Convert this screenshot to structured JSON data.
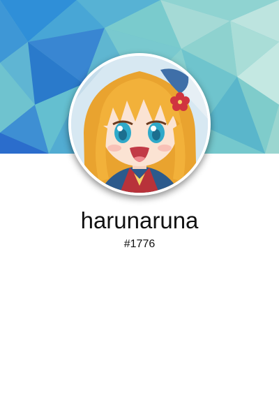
{
  "profile": {
    "username": "harunaruna",
    "discriminator": "#1776"
  },
  "banner": {
    "pattern": "low-poly-triangles",
    "colors": [
      "#2e8fd6",
      "#4aa3d8",
      "#62bcd0",
      "#7ccdcb",
      "#9ad8d2",
      "#b9e3de",
      "#3b7fd1"
    ]
  },
  "avatar": {
    "subject": "anime girl with blonde hair, red flower hair ornament, smiling",
    "colors": {
      "hair": "#f2b13a",
      "skin": "#fbe3d3",
      "eyes": "#2fa9c9",
      "outfit": "#b8323a",
      "background": "#d7e8f2"
    }
  }
}
